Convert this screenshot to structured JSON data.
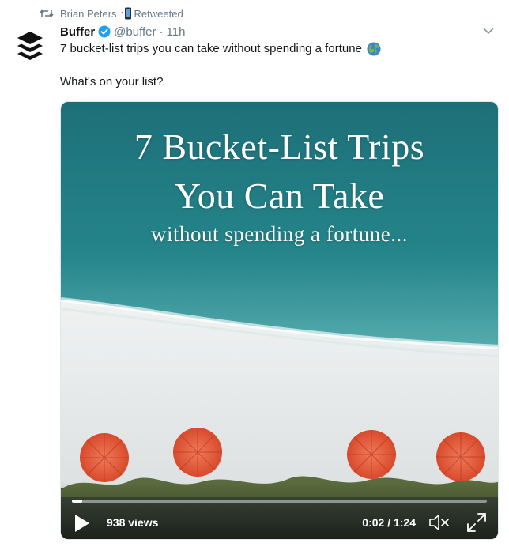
{
  "retweet": {
    "name": "Brian Peters",
    "label": "Retweeted",
    "icon": "retweet-icon"
  },
  "tweet": {
    "author_name": "Buffer",
    "verified": true,
    "handle": "@buffer",
    "separator": "·",
    "time": "11h",
    "text_line1": "7 bucket-list trips you can take without spending a fortune",
    "text_line2": "What's on your list?",
    "emoji": "globe-icon"
  },
  "video": {
    "title_line1": "7 Bucket-List Trips",
    "title_line2": "You Can Take",
    "title_line3": "without spending a fortune...",
    "views": "938 views",
    "timecode": "0:02 / 1:24",
    "progress": 0.024,
    "muted": true
  },
  "colors": {
    "text": "#14171a",
    "muted": "#657786",
    "verified": "#1da1f2",
    "umbrella": "#e8553b",
    "sea": "#1f7f86",
    "sand": "#e9ecee"
  }
}
